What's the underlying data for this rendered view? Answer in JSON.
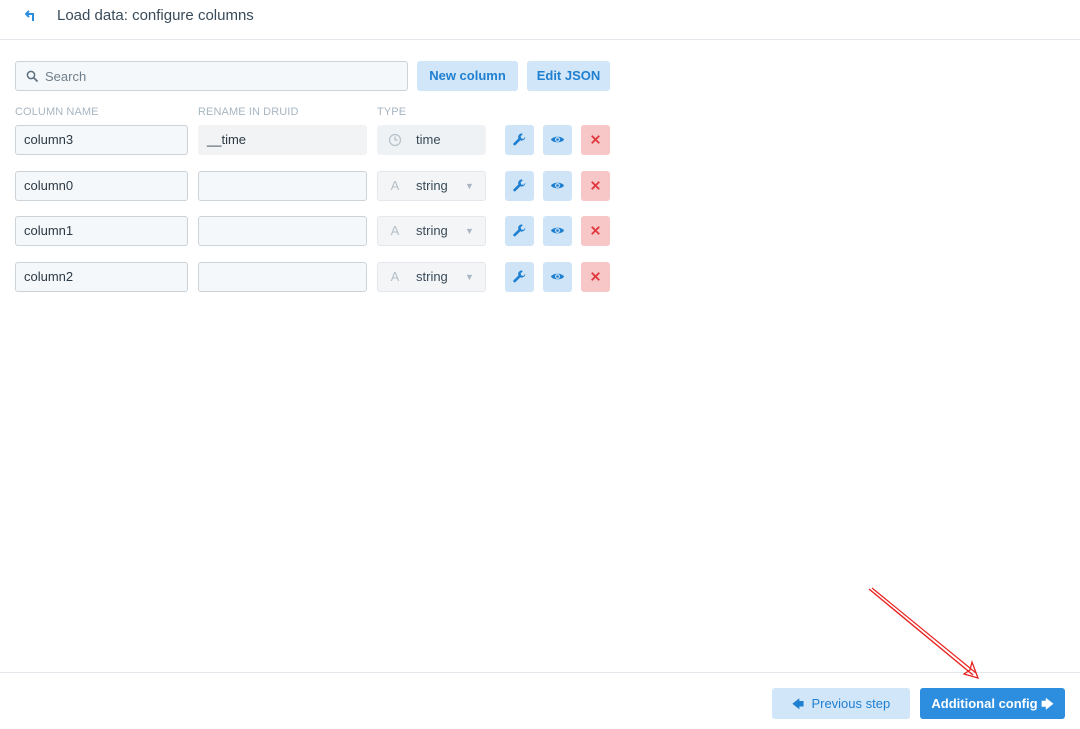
{
  "header": {
    "title": "Load data: configure columns",
    "back_icon": "back-arrow-icon"
  },
  "toolbar": {
    "search_placeholder": "Search",
    "new_column_label": "New column",
    "edit_json_label": "Edit JSON"
  },
  "columns_table": {
    "headers": [
      "COLUMN NAME",
      "RENAME IN DRUID",
      "TYPE"
    ],
    "rows": [
      {
        "name": "column3",
        "rename": "__time",
        "type": "time",
        "type_icon": "clock-icon",
        "editable_type": false
      },
      {
        "name": "column0",
        "rename": "",
        "type": "string",
        "type_icon": "text-icon",
        "editable_type": true
      },
      {
        "name": "column1",
        "rename": "",
        "type": "string",
        "type_icon": "text-icon",
        "editable_type": true
      },
      {
        "name": "column2",
        "rename": "",
        "type": "string",
        "type_icon": "text-icon",
        "editable_type": true
      }
    ],
    "row_actions": [
      "wrench-icon",
      "eye-icon",
      "close-icon"
    ]
  },
  "footer": {
    "previous_label": "Previous step",
    "next_label": "Additional config"
  },
  "colors": {
    "accent": "#2d8ee0",
    "light_button": "#d1e6f8",
    "danger_light": "#f7c6c6",
    "annotation": "#e8231f"
  }
}
